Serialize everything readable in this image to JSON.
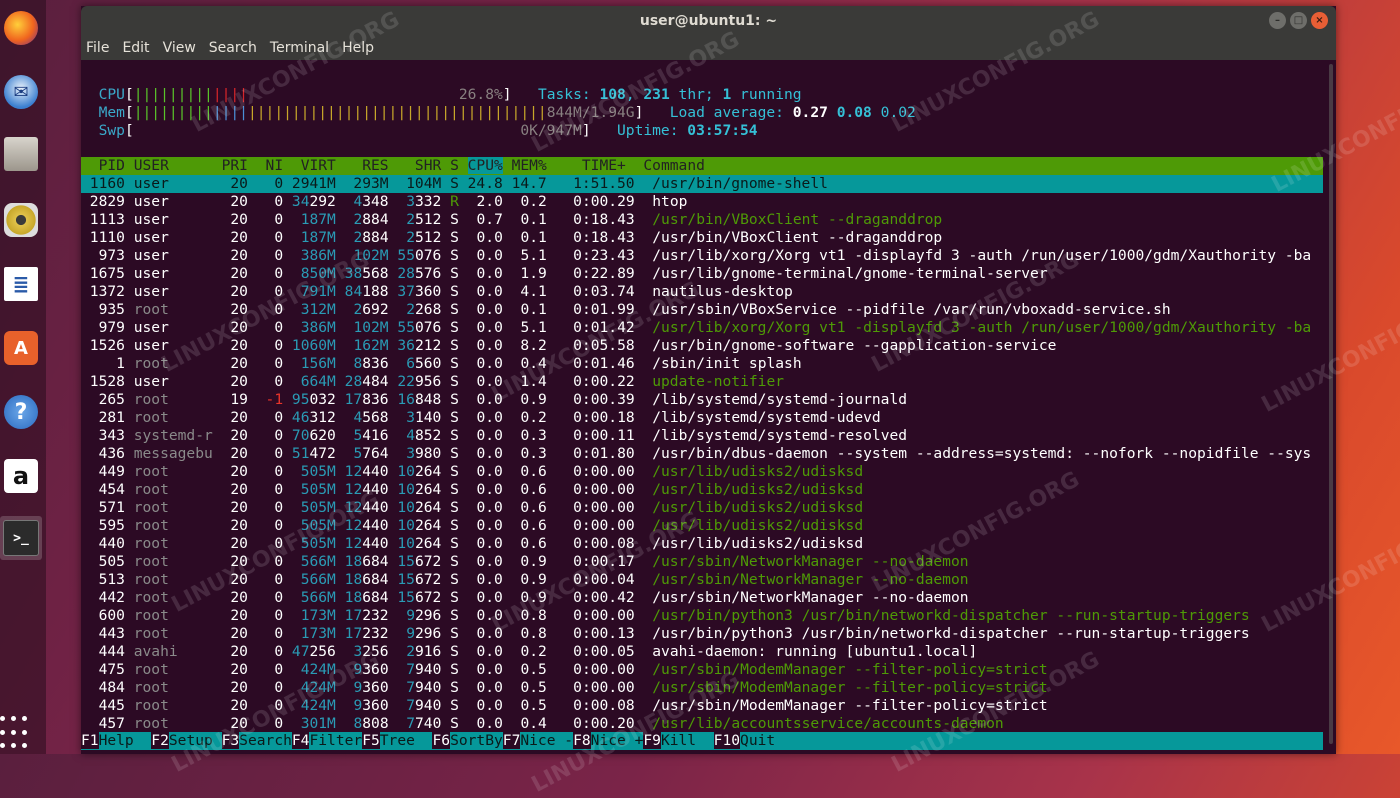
{
  "window": {
    "title": "user@ubuntu1: ~",
    "menu": [
      "File",
      "Edit",
      "View",
      "Search",
      "Terminal",
      "Help"
    ]
  },
  "meters": {
    "cpu_label": "CPU",
    "cpu_value": "26.8%",
    "mem_label": "Mem",
    "mem_value": "844M/1.94G",
    "swp_label": "Swp",
    "swp_value": "0K/947M"
  },
  "summary": {
    "tasks_label": "Tasks: ",
    "tasks": "108",
    "thr": "231",
    "thr_label": " thr; ",
    "running": "1",
    "running_label": " running",
    "load_label": "Load average: ",
    "load1": "0.27",
    "load5": "0.08",
    "load15": "0.02",
    "uptime_label": "Uptime: ",
    "uptime": "03:57:54"
  },
  "header": {
    "pid": "PID",
    "user": "USER",
    "pri": "PRI",
    "ni": "NI",
    "virt": "VIRT",
    "res": "RES",
    "shr": "SHR",
    "s": "S",
    "cpu": "CPU%",
    "mem": "MEM%",
    "time": "TIME+",
    "command": "Command"
  },
  "processes": [
    {
      "pid": "1160",
      "user": "user",
      "pri": "20",
      "ni": "0",
      "virt": "2941M",
      "res": "293M",
      "shr": "104M",
      "s": "S",
      "cpu": "24.8",
      "mem": "14.7",
      "time": "1:51.50",
      "command": "/usr/bin/gnome-shell",
      "selected": true
    },
    {
      "pid": "2829",
      "user": "user",
      "pri": "20",
      "ni": "0",
      "virt": "34292",
      "res": "4348",
      "shr": "3332",
      "s": "R",
      "cpu": "2.0",
      "mem": "0.2",
      "time": "0:00.29",
      "command": "htop"
    },
    {
      "pid": "1113",
      "user": "user",
      "pri": "20",
      "ni": "0",
      "virt": "187M",
      "res": "2884",
      "shr": "2512",
      "s": "S",
      "cpu": "0.7",
      "mem": "0.1",
      "time": "0:18.43",
      "command": "/usr/bin/VBoxClient --draganddrop",
      "thread": true
    },
    {
      "pid": "1110",
      "user": "user",
      "pri": "20",
      "ni": "0",
      "virt": "187M",
      "res": "2884",
      "shr": "2512",
      "s": "S",
      "cpu": "0.0",
      "mem": "0.1",
      "time": "0:18.43",
      "command": "/usr/bin/VBoxClient --draganddrop"
    },
    {
      "pid": "973",
      "user": "user",
      "pri": "20",
      "ni": "0",
      "virt": "386M",
      "res": "102M",
      "shr": "55076",
      "s": "S",
      "cpu": "0.0",
      "mem": "5.1",
      "time": "0:23.43",
      "command": "/usr/lib/xorg/Xorg vt1 -displayfd 3 -auth /run/user/1000/gdm/Xauthority -ba"
    },
    {
      "pid": "1675",
      "user": "user",
      "pri": "20",
      "ni": "0",
      "virt": "850M",
      "res": "38568",
      "shr": "28576",
      "s": "S",
      "cpu": "0.0",
      "mem": "1.9",
      "time": "0:22.89",
      "command": "/usr/lib/gnome-terminal/gnome-terminal-server"
    },
    {
      "pid": "1372",
      "user": "user",
      "pri": "20",
      "ni": "0",
      "virt": "791M",
      "res": "84188",
      "shr": "37360",
      "s": "S",
      "cpu": "0.0",
      "mem": "4.1",
      "time": "0:03.74",
      "command": "nautilus-desktop"
    },
    {
      "pid": "935",
      "user": "root",
      "pri": "20",
      "ni": "0",
      "virt": "312M",
      "res": "2692",
      "shr": "2268",
      "s": "S",
      "cpu": "0.0",
      "mem": "0.1",
      "time": "0:01.99",
      "command": "/usr/sbin/VBoxService --pidfile /var/run/vboxadd-service.sh"
    },
    {
      "pid": "979",
      "user": "user",
      "pri": "20",
      "ni": "0",
      "virt": "386M",
      "res": "102M",
      "shr": "55076",
      "s": "S",
      "cpu": "0.0",
      "mem": "5.1",
      "time": "0:01.42",
      "command": "/usr/lib/xorg/Xorg vt1 -displayfd 3 -auth /run/user/1000/gdm/Xauthority -ba",
      "thread": true
    },
    {
      "pid": "1526",
      "user": "user",
      "pri": "20",
      "ni": "0",
      "virt": "1060M",
      "res": "162M",
      "shr": "36212",
      "s": "S",
      "cpu": "0.0",
      "mem": "8.2",
      "time": "0:05.58",
      "command": "/usr/bin/gnome-software --gapplication-service"
    },
    {
      "pid": "1",
      "user": "root",
      "pri": "20",
      "ni": "0",
      "virt": "156M",
      "res": "8836",
      "shr": "6560",
      "s": "S",
      "cpu": "0.0",
      "mem": "0.4",
      "time": "0:01.46",
      "command": "/sbin/init splash"
    },
    {
      "pid": "1528",
      "user": "user",
      "pri": "20",
      "ni": "0",
      "virt": "664M",
      "res": "28484",
      "shr": "22956",
      "s": "S",
      "cpu": "0.0",
      "mem": "1.4",
      "time": "0:00.22",
      "command": "update-notifier",
      "thread": true
    },
    {
      "pid": "265",
      "user": "root",
      "pri": "19",
      "ni": "-1",
      "virt": "95032",
      "res": "17836",
      "shr": "16848",
      "s": "S",
      "cpu": "0.0",
      "mem": "0.9",
      "time": "0:00.39",
      "command": "/lib/systemd/systemd-journald"
    },
    {
      "pid": "281",
      "user": "root",
      "pri": "20",
      "ni": "0",
      "virt": "46312",
      "res": "4568",
      "shr": "3140",
      "s": "S",
      "cpu": "0.0",
      "mem": "0.2",
      "time": "0:00.18",
      "command": "/lib/systemd/systemd-udevd"
    },
    {
      "pid": "343",
      "user": "systemd-r",
      "pri": "20",
      "ni": "0",
      "virt": "70620",
      "res": "5416",
      "shr": "4852",
      "s": "S",
      "cpu": "0.0",
      "mem": "0.3",
      "time": "0:00.11",
      "command": "/lib/systemd/systemd-resolved"
    },
    {
      "pid": "436",
      "user": "messagebu",
      "pri": "20",
      "ni": "0",
      "virt": "51472",
      "res": "5764",
      "shr": "3980",
      "s": "S",
      "cpu": "0.0",
      "mem": "0.3",
      "time": "0:01.80",
      "command": "/usr/bin/dbus-daemon --system --address=systemd: --nofork --nopidfile --sys"
    },
    {
      "pid": "449",
      "user": "root",
      "pri": "20",
      "ni": "0",
      "virt": "505M",
      "res": "12440",
      "shr": "10264",
      "s": "S",
      "cpu": "0.0",
      "mem": "0.6",
      "time": "0:00.00",
      "command": "/usr/lib/udisks2/udisksd",
      "thread": true
    },
    {
      "pid": "454",
      "user": "root",
      "pri": "20",
      "ni": "0",
      "virt": "505M",
      "res": "12440",
      "shr": "10264",
      "s": "S",
      "cpu": "0.0",
      "mem": "0.6",
      "time": "0:00.00",
      "command": "/usr/lib/udisks2/udisksd",
      "thread": true
    },
    {
      "pid": "571",
      "user": "root",
      "pri": "20",
      "ni": "0",
      "virt": "505M",
      "res": "12440",
      "shr": "10264",
      "s": "S",
      "cpu": "0.0",
      "mem": "0.6",
      "time": "0:00.00",
      "command": "/usr/lib/udisks2/udisksd",
      "thread": true
    },
    {
      "pid": "595",
      "user": "root",
      "pri": "20",
      "ni": "0",
      "virt": "505M",
      "res": "12440",
      "shr": "10264",
      "s": "S",
      "cpu": "0.0",
      "mem": "0.6",
      "time": "0:00.00",
      "command": "/usr/lib/udisks2/udisksd",
      "thread": true
    },
    {
      "pid": "440",
      "user": "root",
      "pri": "20",
      "ni": "0",
      "virt": "505M",
      "res": "12440",
      "shr": "10264",
      "s": "S",
      "cpu": "0.0",
      "mem": "0.6",
      "time": "0:00.08",
      "command": "/usr/lib/udisks2/udisksd"
    },
    {
      "pid": "505",
      "user": "root",
      "pri": "20",
      "ni": "0",
      "virt": "566M",
      "res": "18684",
      "shr": "15672",
      "s": "S",
      "cpu": "0.0",
      "mem": "0.9",
      "time": "0:00.17",
      "command": "/usr/sbin/NetworkManager --no-daemon",
      "thread": true
    },
    {
      "pid": "513",
      "user": "root",
      "pri": "20",
      "ni": "0",
      "virt": "566M",
      "res": "18684",
      "shr": "15672",
      "s": "S",
      "cpu": "0.0",
      "mem": "0.9",
      "time": "0:00.04",
      "command": "/usr/sbin/NetworkManager --no-daemon",
      "thread": true
    },
    {
      "pid": "442",
      "user": "root",
      "pri": "20",
      "ni": "0",
      "virt": "566M",
      "res": "18684",
      "shr": "15672",
      "s": "S",
      "cpu": "0.0",
      "mem": "0.9",
      "time": "0:00.42",
      "command": "/usr/sbin/NetworkManager --no-daemon"
    },
    {
      "pid": "600",
      "user": "root",
      "pri": "20",
      "ni": "0",
      "virt": "173M",
      "res": "17232",
      "shr": "9296",
      "s": "S",
      "cpu": "0.0",
      "mem": "0.8",
      "time": "0:00.00",
      "command": "/usr/bin/python3 /usr/bin/networkd-dispatcher --run-startup-triggers",
      "thread": true
    },
    {
      "pid": "443",
      "user": "root",
      "pri": "20",
      "ni": "0",
      "virt": "173M",
      "res": "17232",
      "shr": "9296",
      "s": "S",
      "cpu": "0.0",
      "mem": "0.8",
      "time": "0:00.13",
      "command": "/usr/bin/python3 /usr/bin/networkd-dispatcher --run-startup-triggers"
    },
    {
      "pid": "444",
      "user": "avahi",
      "pri": "20",
      "ni": "0",
      "virt": "47256",
      "res": "3256",
      "shr": "2916",
      "s": "S",
      "cpu": "0.0",
      "mem": "0.2",
      "time": "0:00.05",
      "command": "avahi-daemon: running [ubuntu1.local]"
    },
    {
      "pid": "475",
      "user": "root",
      "pri": "20",
      "ni": "0",
      "virt": "424M",
      "res": "9360",
      "shr": "7940",
      "s": "S",
      "cpu": "0.0",
      "mem": "0.5",
      "time": "0:00.00",
      "command": "/usr/sbin/ModemManager --filter-policy=strict",
      "thread": true
    },
    {
      "pid": "484",
      "user": "root",
      "pri": "20",
      "ni": "0",
      "virt": "424M",
      "res": "9360",
      "shr": "7940",
      "s": "S",
      "cpu": "0.0",
      "mem": "0.5",
      "time": "0:00.00",
      "command": "/usr/sbin/ModemManager --filter-policy=strict",
      "thread": true
    },
    {
      "pid": "445",
      "user": "root",
      "pri": "20",
      "ni": "0",
      "virt": "424M",
      "res": "9360",
      "shr": "7940",
      "s": "S",
      "cpu": "0.0",
      "mem": "0.5",
      "time": "0:00.08",
      "command": "/usr/sbin/ModemManager --filter-policy=strict"
    },
    {
      "pid": "457",
      "user": "root",
      "pri": "20",
      "ni": "0",
      "virt": "301M",
      "res": "8808",
      "shr": "7740",
      "s": "S",
      "cpu": "0.0",
      "mem": "0.4",
      "time": "0:00.20",
      "command": "/usr/lib/accountsservice/accounts-daemon",
      "thread": true
    }
  ],
  "fkeys": [
    {
      "key": "F1",
      "label": "Help  "
    },
    {
      "key": "F2",
      "label": "Setup "
    },
    {
      "key": "F3",
      "label": "Search"
    },
    {
      "key": "F4",
      "label": "Filter"
    },
    {
      "key": "F5",
      "label": "Tree  "
    },
    {
      "key": "F6",
      "label": "SortBy"
    },
    {
      "key": "F7",
      "label": "Nice -"
    },
    {
      "key": "F8",
      "label": "Nice +"
    },
    {
      "key": "F9",
      "label": "Kill  "
    },
    {
      "key": "F10",
      "label": "Quit"
    }
  ],
  "watermark": "LINUXCONFIG.ORG",
  "dock": [
    "firefox-icon",
    "thunderbird-icon",
    "files-icon",
    "rhythmbox-icon",
    "writer-icon",
    "software-icon",
    "help-icon",
    "amazon-icon",
    "terminal-icon"
  ]
}
